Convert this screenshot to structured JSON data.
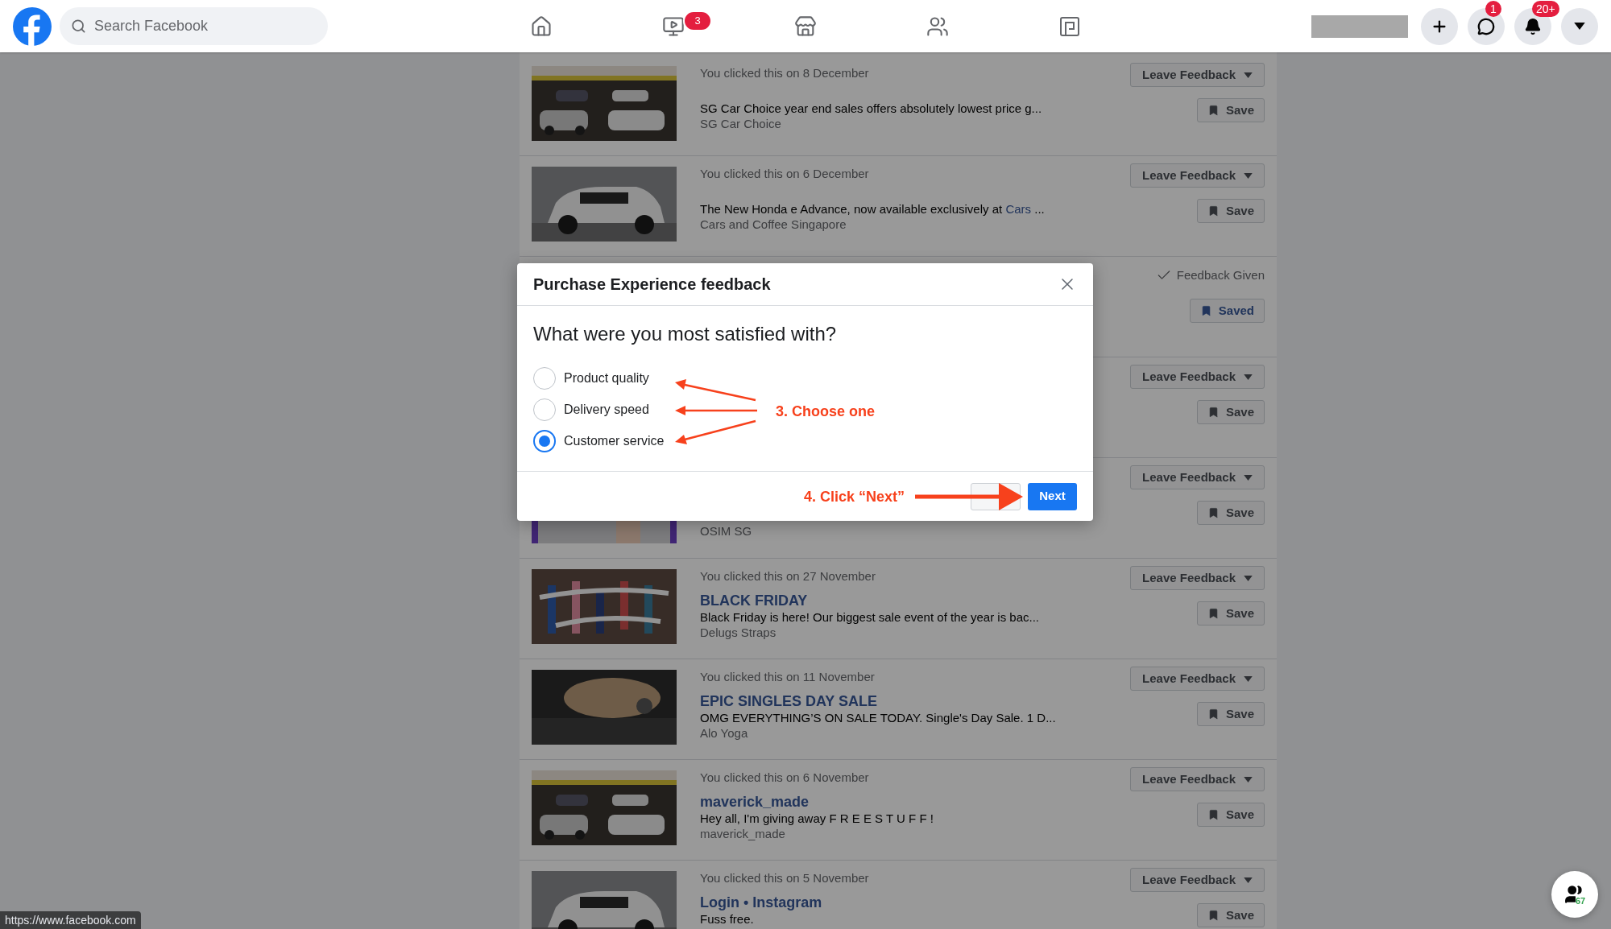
{
  "top_bar": {
    "search": {
      "placeholder": "Search Facebook"
    },
    "nav": [
      {
        "kind": "home"
      },
      {
        "kind": "video",
        "badge": "3"
      },
      {
        "kind": "store"
      },
      {
        "kind": "groups"
      },
      {
        "kind": "gaming"
      }
    ],
    "actions": [
      {
        "kind": "create"
      },
      {
        "kind": "messenger",
        "badge": "1"
      },
      {
        "kind": "notifications",
        "badge": "20+"
      },
      {
        "kind": "account"
      }
    ]
  },
  "items": [
    {
      "date": "You clicked this on 8 December",
      "description": {
        "text": "SG Car Choice year end sales offers absolutely lowest price g..."
      },
      "source": "SG Car Choice",
      "feedback": {
        "given": false,
        "label": "Leave Feedback"
      },
      "save": {
        "saved": false,
        "label": "Save"
      }
    },
    {
      "date": "You clicked this on 6 December",
      "description": {
        "text": "The New Honda e Advance, now available exclusively at ",
        "link": "Cars",
        "tail": " ..."
      },
      "source": "Cars and Coffee Singapore",
      "feedback": {
        "given": false,
        "label": "Leave Feedback"
      },
      "save": {
        "saved": false,
        "label": "Save"
      }
    },
    {
      "feedback": {
        "given": true,
        "label": "Feedback Given"
      },
      "save": {
        "saved": true,
        "label": "Saved"
      }
    },
    {
      "feedback": {
        "given": false,
        "label": "Leave Feedback"
      },
      "save": {
        "saved": false,
        "label": "Save"
      }
    },
    {
      "source": "OSIM SG",
      "feedback": {
        "given": false,
        "label": "Leave Feedback"
      },
      "save": {
        "saved": false,
        "label": "Save"
      }
    },
    {
      "date": "You clicked this on 27 November",
      "title": "BLACK FRIDAY",
      "description": {
        "text": "Black Friday is here! Our biggest sale event of the year is bac..."
      },
      "source": "Delugs Straps",
      "feedback": {
        "given": false,
        "label": "Leave Feedback"
      },
      "save": {
        "saved": false,
        "label": "Save"
      }
    },
    {
      "date": "You clicked this on 11 November",
      "title": "EPIC SINGLES DAY SALE",
      "description": {
        "text": "OMG EVERYTHING’S ON SALE TODAY. Single's Day Sale. 1 D..."
      },
      "source": "Alo Yoga",
      "feedback": {
        "given": false,
        "label": "Leave Feedback"
      },
      "save": {
        "saved": false,
        "label": "Save"
      }
    },
    {
      "date": "You clicked this on 6 November",
      "title": "maverick_made",
      "description": {
        "text": "Hey all, I'm giving away F R E E S T U F F !"
      },
      "source": "maverick_made",
      "feedback": {
        "given": false,
        "label": "Leave Feedback"
      },
      "save": {
        "saved": false,
        "label": "Save"
      }
    },
    {
      "date": "You clicked this on 5 November",
      "title": "Login • Instagram",
      "description": {
        "text": "Fuss free."
      },
      "feedback": {
        "given": false,
        "label": "Leave Feedback"
      },
      "save": {
        "saved": false,
        "label": "Save"
      }
    }
  ],
  "dialog": {
    "title": "Purchase Experience feedback",
    "question": "What were you most satisfied with?",
    "options": [
      {
        "label": "Product quality",
        "selected": false
      },
      {
        "label": "Delivery speed",
        "selected": false
      },
      {
        "label": "Customer service",
        "selected": true
      }
    ],
    "buttons": [
      {
        "kind": "secondary"
      },
      {
        "kind": "primary",
        "label": "Next"
      }
    ]
  },
  "annotations": [
    {
      "kind": "choose",
      "text": "3. Choose one"
    },
    {
      "kind": "click",
      "text": "4. Click “Next”"
    }
  ],
  "status_bar": {
    "url": "https://www.facebook.com"
  },
  "contacts_button": {
    "count": "67"
  }
}
